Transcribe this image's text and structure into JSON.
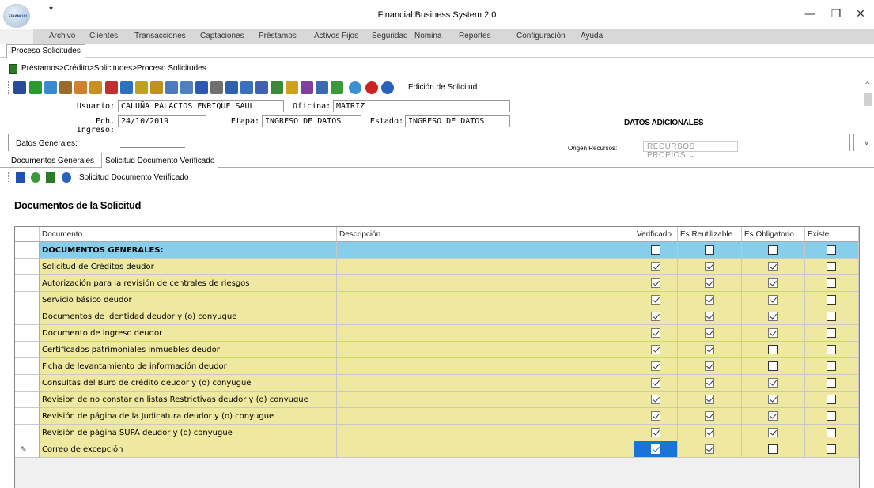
{
  "window": {
    "title": "Financial Business System 2.0",
    "logo_text": "FINANCIAL",
    "qa_glyph": "▾",
    "minimize": "—",
    "maximize": "❐",
    "close": "✕"
  },
  "menu": [
    "Archivo",
    "Clientes",
    "Transacciones",
    "Captaciones",
    "Préstamos",
    "Activos Fijos",
    "Seguridad",
    "Nomina",
    "Reportes",
    "Configuración",
    "Ayuda"
  ],
  "doc_tab": "Proceso Solicitudes",
  "breadcrumb": "Préstamos>Crédito>Solicitudes>Proceso Solicitudes",
  "toolbar_title": "Edición de Solicitud",
  "form": {
    "usuario_label": "Usuario:",
    "usuario": "CALUÑA PALACIOS ENRIQUE SAUL",
    "oficina_label": "Oficina:",
    "oficina": "MATRIZ",
    "fch_label": "Fch. Ingreso:",
    "fch": "24/10/2019",
    "etapa_label": "Etapa:",
    "etapa": "INGRESO DE DATOS",
    "estado_label": "Estado:",
    "estado": "INGRESO DE DATOS",
    "datos_adicionales": "DATOS ADICIONALES",
    "datos_generales": "Datos Generales:",
    "origen_label": "Origen Recursos:",
    "origen": "RECURSOS PROPIOS ⌄"
  },
  "scroll": {
    "up": "^",
    "down": "v"
  },
  "inner_tabs": [
    "Documentos Generales",
    "Solicitud Documento Verificado"
  ],
  "sub_toolbar_title": "Solicitud Documento Verificado",
  "heading": "Documentos de la Solicitud",
  "grid": {
    "headers": [
      "Documento",
      "Descripción",
      "Verificado",
      "Es Reutilizable",
      "Es Obligatorio",
      "Existe"
    ],
    "rows": [
      {
        "doc": "DOCUMENTOS GENERALES:",
        "desc": "",
        "v": false,
        "r": false,
        "o": false,
        "e": false,
        "group": true
      },
      {
        "doc": "Solicitud de Créditos deudor",
        "desc": "",
        "v": true,
        "r": true,
        "o": true,
        "e": false
      },
      {
        "doc": "Autorización para la revisión de centrales de riesgos",
        "desc": "",
        "v": true,
        "r": true,
        "o": true,
        "e": false
      },
      {
        "doc": "Servicio básico deudor",
        "desc": "",
        "v": true,
        "r": true,
        "o": true,
        "e": false
      },
      {
        "doc": "Documentos de Identidad deudor y (o) conyugue",
        "desc": "",
        "v": true,
        "r": true,
        "o": true,
        "e": false
      },
      {
        "doc": "Documento de ingreso deudor",
        "desc": "",
        "v": true,
        "r": true,
        "o": true,
        "e": false
      },
      {
        "doc": "Certificados patrimoniales inmuebles deudor",
        "desc": "",
        "v": true,
        "r": true,
        "o": false,
        "e": false
      },
      {
        "doc": "Ficha de levantamiento de información deudor",
        "desc": "",
        "v": true,
        "r": true,
        "o": false,
        "e": false
      },
      {
        "doc": "Consultas del Buro de crédito deudor y (o) conyugue",
        "desc": "",
        "v": true,
        "r": true,
        "o": true,
        "e": false
      },
      {
        "doc": "Revision de no constar en listas Restrictivas deudor y (o) conyugue",
        "desc": "",
        "v": true,
        "r": true,
        "o": true,
        "e": false
      },
      {
        "doc": "Revisión de página de la Judicatura deudor y (o) conyugue",
        "desc": "",
        "v": true,
        "r": true,
        "o": true,
        "e": false
      },
      {
        "doc": "Revisión de página SUPA deudor y (o) conyugue",
        "desc": "",
        "v": true,
        "r": true,
        "o": true,
        "e": false
      },
      {
        "doc": "Correo de excepción",
        "desc": "",
        "v": true,
        "r": true,
        "o": false,
        "e": false,
        "editing": true
      }
    ]
  },
  "colors": {
    "group_row": "#87ceeb",
    "row": "#eee8a0",
    "selected": "#1a73d9"
  },
  "row_marker": "✎"
}
